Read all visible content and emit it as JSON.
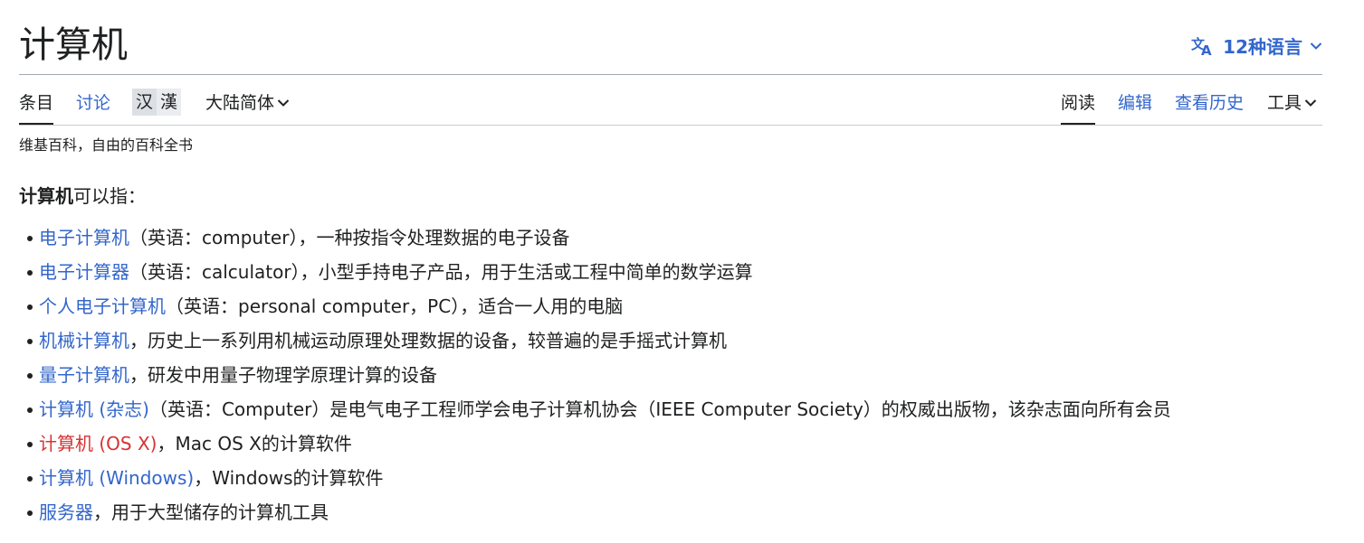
{
  "header": {
    "title": "计算机",
    "languages_label": "12种语言",
    "languages_icon": "translate-icon"
  },
  "tabs": {
    "article": "条目",
    "talk": "讨论",
    "variant_simplified": "汉",
    "variant_traditional": "漢",
    "variant_dropdown": "大陆简体",
    "read": "阅读",
    "edit": "编辑",
    "history": "查看历史",
    "tools": "工具"
  },
  "tagline": "维基百科，自由的百科全书",
  "intro": {
    "bold": "计算机",
    "rest": "可以指："
  },
  "entries": [
    {
      "link": "电子计算机",
      "text": "（英语：computer），一种按指令处理数据的电子设备",
      "missing": false
    },
    {
      "link": "电子计算器",
      "text": "（英语：calculator），小型手持电子产品，用于生活或工程中简单的数学运算",
      "missing": false
    },
    {
      "link": "个人电子计算机",
      "text": "（英语：personal computer，PC），适合一人用的电脑",
      "missing": false
    },
    {
      "link": "机械计算机",
      "text": "，历史上一系列用机械运动原理处理数据的设备，较普遍的是手摇式计算机",
      "missing": false
    },
    {
      "link": "量子计算机",
      "text": "，研发中用量子物理学原理计算的设备",
      "missing": false
    },
    {
      "link": "计算机 (杂志)",
      "text": "（英语：Computer）是电气电子工程师学会电子计算机协会（IEEE Computer Society）的权威出版物，该杂志面向所有会员",
      "missing": false
    },
    {
      "link": "计算机 (OS X)",
      "text": "，Mac OS X的计算软件",
      "missing": true
    },
    {
      "link": "计算机 (Windows)",
      "text": "，Windows的计算软件",
      "missing": false
    },
    {
      "link": "服务器",
      "text": "，用于大型储存的计算机工具",
      "missing": false
    }
  ],
  "colors": {
    "link": "#3366cc",
    "missing_link": "#d73333",
    "text": "#202122"
  }
}
